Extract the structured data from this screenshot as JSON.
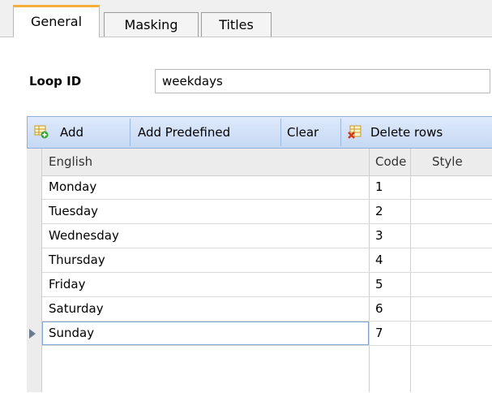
{
  "tabs": [
    {
      "label": "General",
      "active": true
    },
    {
      "label": "Masking",
      "active": false
    },
    {
      "label": "Titles",
      "active": false
    }
  ],
  "loop": {
    "label": "Loop ID",
    "value": "weekdays"
  },
  "toolbar": {
    "add_label": "Add",
    "add_predefined_label": "Add Predefined",
    "clear_label": "Clear",
    "delete_rows_label": "Delete rows",
    "add_icon": "grid-add-icon",
    "delete_icon": "grid-delete-icon"
  },
  "grid": {
    "columns": [
      "English",
      "Code",
      "Style"
    ],
    "rows": [
      {
        "english": "Monday",
        "code": "1",
        "style": ""
      },
      {
        "english": "Tuesday",
        "code": "2",
        "style": ""
      },
      {
        "english": "Wednesday",
        "code": "3",
        "style": ""
      },
      {
        "english": "Thursday",
        "code": "4",
        "style": ""
      },
      {
        "english": "Friday",
        "code": "5",
        "style": ""
      },
      {
        "english": "Saturday",
        "code": "6",
        "style": ""
      },
      {
        "english": "Sunday",
        "code": "7",
        "style": ""
      }
    ],
    "selected_row": 6
  },
  "colors": {
    "tab_accent": "#f5b03c",
    "toolbar_bg": "#c5d8f3",
    "selection_border": "#7fa7d6"
  }
}
